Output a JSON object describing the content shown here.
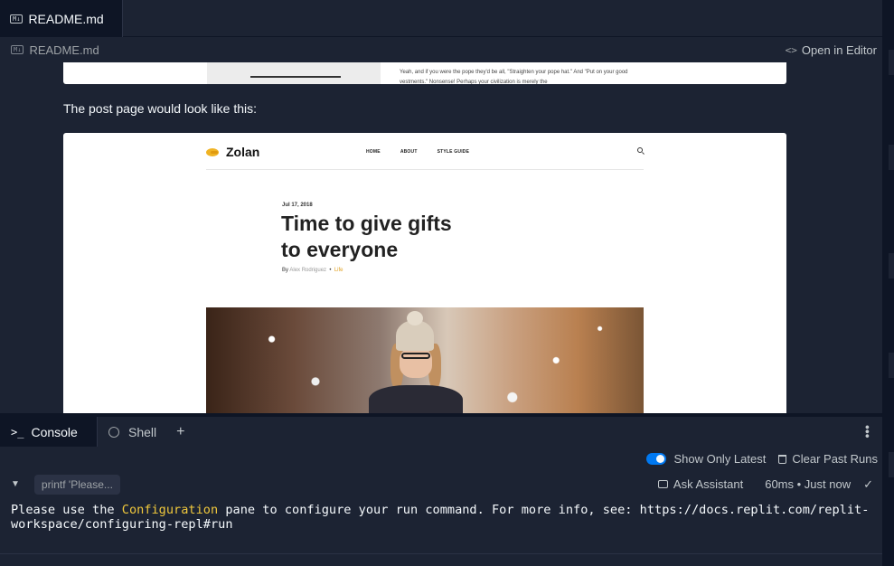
{
  "tabbar": {
    "tab_icon": "M↓",
    "tab_label": "README.md"
  },
  "filebar": {
    "icon": "M↓",
    "file_name": "README.md",
    "open_editor_label": "Open in Editor",
    "open_editor_icon": "code-icon"
  },
  "preview": {
    "top_image_text": "Yeah, and if you were the pope they'd be all, \"Straighten your pope hat.\" And \"Put on your good vestments.\" Nonsense! Perhaps your civilization is merely the",
    "caption": "The post page would look like this:",
    "post": {
      "logo": "Zolan",
      "nav": [
        "HOME",
        "ABOUT",
        "STYLE GUIDE"
      ],
      "date": "Jul 17, 2018",
      "title_line1": "Time to give gifts",
      "title_line2": "to everyone",
      "by": "By",
      "author": "Alex Rodriguez",
      "bullet": "•",
      "category": "Life"
    }
  },
  "console": {
    "tabs": [
      {
        "icon": ">_",
        "label": "Console"
      },
      {
        "icon": "shell-icon",
        "label": "Shell"
      }
    ],
    "add_tab": "+",
    "menu": "⋮",
    "show_only_latest": "Show Only Latest",
    "show_only_latest_on": true,
    "clear_past_runs": "Clear Past Runs",
    "chevron": "⌄",
    "command": "printf 'Please...",
    "ask_assistant": "Ask Assistant",
    "runtime": "60ms • Just now",
    "check": "✓",
    "output_pre": "Please use the ",
    "output_highlight": "Configuration",
    "output_post": " pane to configure your run command. For more info, see: https://docs.replit.com/replit-workspace/configuring-repl#run"
  },
  "colors": {
    "bg": "#0e1525",
    "panel": "#1c2333",
    "accent": "#0079f2",
    "highlight": "#f0c83c",
    "logo": "#f0b323"
  }
}
